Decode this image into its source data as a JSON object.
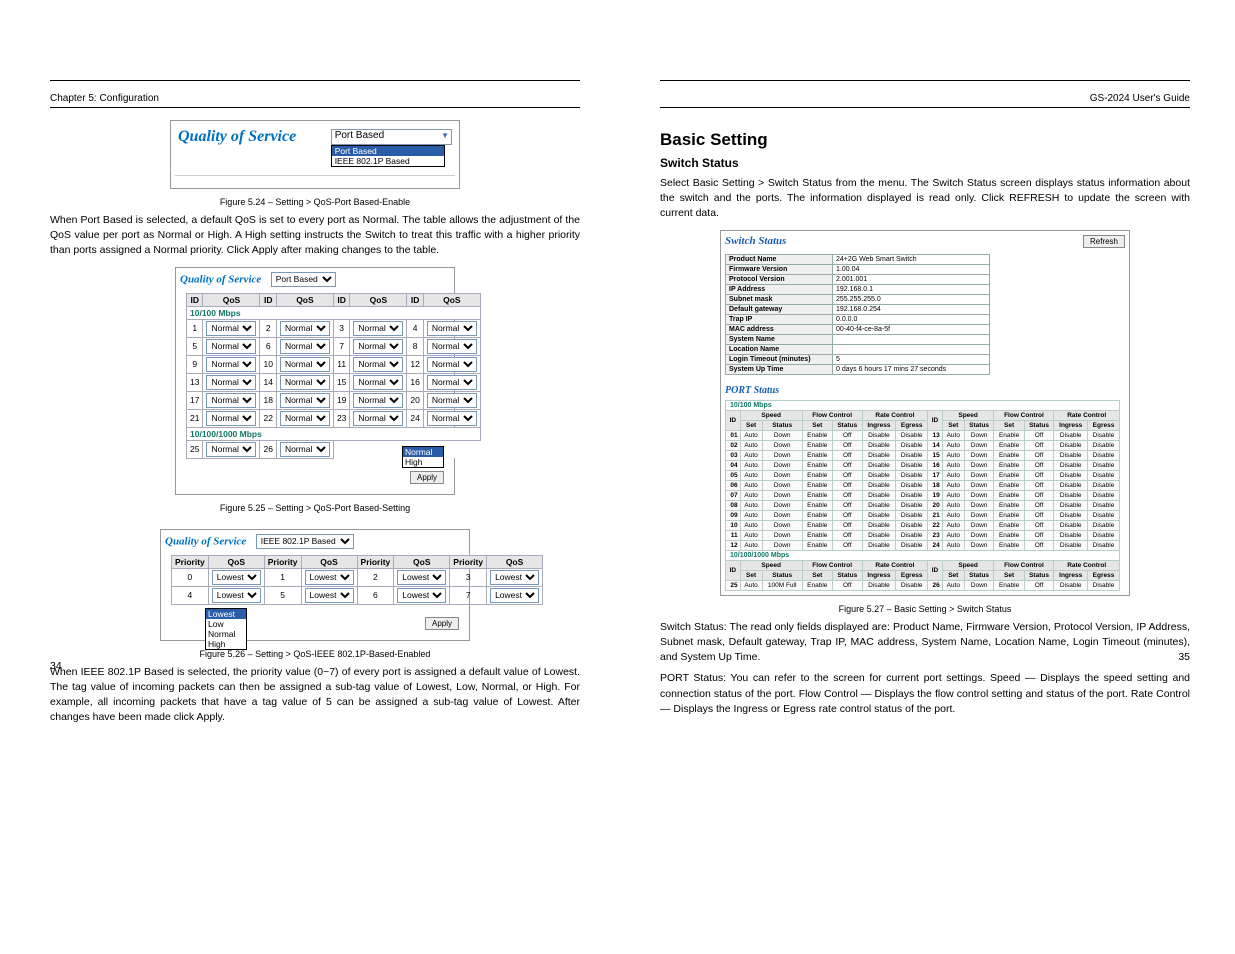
{
  "doc": {
    "chapter": "Chapter 5: Configuration",
    "left_page_num": "34",
    "right_page_num": "35",
    "right_toc": "GS-2024 User's Guide"
  },
  "qos_top": {
    "title": "Quality of Service",
    "select_value": "Port Based",
    "options": [
      "Port Based",
      "IEEE 802.1P Based"
    ],
    "caption": "Figure 5.24 – Setting > QoS-Port Based-Enable"
  },
  "qos_port": {
    "title": "Quality of Service",
    "select_value": "Port Based",
    "header_id": "ID",
    "header_qos": "QoS",
    "section1": "10/100 Mbps",
    "section2": "10/100/1000 Mbps",
    "qos_value": "Normal",
    "row1": [
      "1",
      "2",
      "3",
      "4"
    ],
    "row2": [
      "5",
      "6",
      "7",
      "8"
    ],
    "row3": [
      "9",
      "10",
      "11",
      "12"
    ],
    "row4": [
      "13",
      "14",
      "15",
      "16"
    ],
    "row5": [
      "17",
      "18",
      "19",
      "20"
    ],
    "row6": [
      "21",
      "22",
      "23",
      "24"
    ],
    "row7": [
      "25",
      "26"
    ],
    "opt_normal": "Normal",
    "opt_high": "High",
    "apply": "Apply",
    "caption": "Figure 5.25 – Setting > QoS-Port Based-Setting"
  },
  "qos_pre": "When Port Based is selected, a default QoS is set to every port as Normal. The table allows the adjustment of the QoS value per port as Normal or High. A High setting instructs the Switch to treat this traffic with a higher priority than ports assigned a Normal priority. Click Apply after making changes to the table.",
  "qos_ieee": {
    "title": "Quality of Service",
    "select_value": "IEEE 802.1P Based",
    "header_pri": "Priority",
    "header_qos": "QoS",
    "ids": [
      "0",
      "1",
      "2",
      "3",
      "4",
      "5",
      "6",
      "7"
    ],
    "qos_value": "Lowest",
    "options": [
      "Lowest",
      "Low",
      "Normal",
      "High"
    ],
    "apply": "Apply",
    "caption": "Figure 5.26 – Setting > QoS-IEEE 802.1P-Based-Enabled"
  },
  "qos_close": "When IEEE 802.1P Based is selected, the priority value (0~7) of every port is assigned a default value of Lowest. The tag value of incoming packets can then be assigned a sub-tag value of Lowest, Low, Normal, or High. For example, all incoming packets that have a tag value of 5 can be assigned a sub-tag value of Lowest. After changes have been made click Apply.",
  "text_right": {
    "h2": "Basic Setting",
    "h3": "Switch Status",
    "para1": "Select Basic Setting > Switch Status from the menu. The Switch Status screen displays status information about the switch and the ports. The information displayed is read only. Click REFRESH to update the screen with current data.",
    "para2_a": "Switch Status: The read only fields displayed are: Product Name, Firmware Version, Protocol Version, IP Address, Subnet mask, Default gateway, Trap IP, MAC address, System Name, Location Name, Login Timeout (minutes), and System Up Time.",
    "para2_b": "PORT Status: You can refer to the screen for current port settings. Speed — Displays the speed setting and connection status of the port. Flow Control — Displays the flow control setting and status of the port. Rate Control — Displays the Ingress or Egress rate control status of the port.",
    "caption": "Figure 5.27 – Basic Setting > Switch Status"
  },
  "switch_status": {
    "title": "Switch Status",
    "refresh": "Refresh",
    "rows": [
      [
        "Product Name",
        "24+2G Web Smart Switch"
      ],
      [
        "Firmware Version",
        "1.00.04"
      ],
      [
        "Protocol Version",
        "2.001.001"
      ],
      [
        "IP Address",
        "192.168.0.1"
      ],
      [
        "Subnet mask",
        "255.255.255.0"
      ],
      [
        "Default gateway",
        "192.168.0.254"
      ],
      [
        "Trap IP",
        "0.0.0.0"
      ],
      [
        "MAC address",
        "00-40-f4-ce-8a-5f"
      ],
      [
        "System Name",
        ""
      ],
      [
        "Location Name",
        ""
      ],
      [
        "Login Timeout (minutes)",
        "5"
      ],
      [
        "System Up Time",
        "0 days 6 hours 17 mins 27 seconds"
      ]
    ]
  },
  "port_status": {
    "title": "PORT Status",
    "section1": "10/100 Mbps",
    "section2": "10/100/1000 Mbps",
    "h_id": "ID",
    "h_speed": "Speed",
    "h_flow": "Flow Control",
    "h_rate": "Rate Control",
    "sub_set": "Set",
    "sub_status": "Status",
    "sub_in": "Ingress",
    "sub_eg": "Egress",
    "auto": "Auto",
    "down": "Down",
    "enable": "Enable",
    "off": "Off",
    "disable": "Disable",
    "full": "100M Full"
  }
}
